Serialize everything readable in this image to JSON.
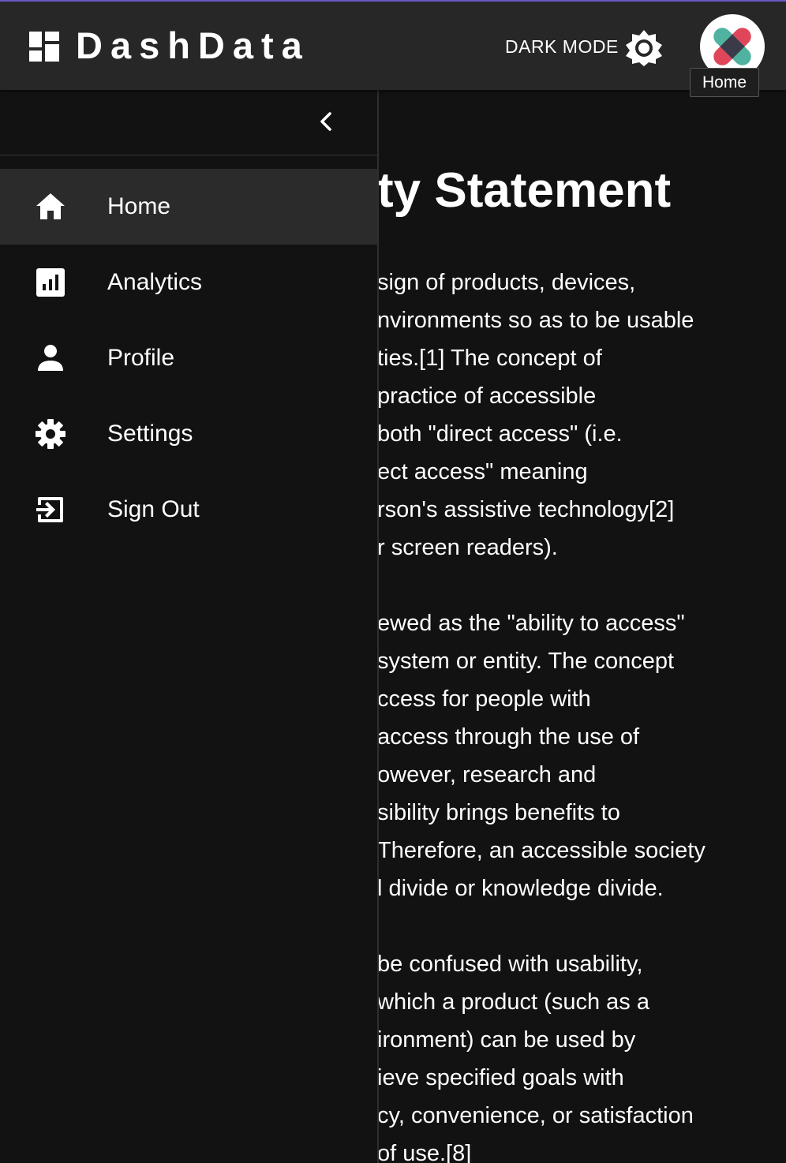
{
  "app": {
    "brand": "DashData",
    "dark_mode_label": "DARK MODE",
    "tooltip": "Home"
  },
  "colors": {
    "appbar_bg": "#272727",
    "page_bg": "#121212",
    "accent_top": "#6a5acd",
    "logo_red": "#e0465a",
    "logo_teal": "#4fb3a0"
  },
  "sidebar": {
    "items": [
      {
        "label": "Home",
        "icon": "home-icon",
        "active": true
      },
      {
        "label": "Analytics",
        "icon": "analytics-icon",
        "active": false
      },
      {
        "label": "Profile",
        "icon": "person-icon",
        "active": false
      },
      {
        "label": "Settings",
        "icon": "gear-icon",
        "active": false
      },
      {
        "label": "Sign Out",
        "icon": "sign-out-icon",
        "active": false
      }
    ]
  },
  "main": {
    "title": "ty Statement",
    "paragraphs": [
      [
        "sign of products, devices,",
        "nvironments so as to be usable",
        "ties.[1] The concept of",
        " practice of accessible",
        "both \"direct access\" (i.e.",
        "ect access\" meaning",
        "rson's assistive technology[2]",
        "r screen readers)."
      ],
      [
        "ewed as the \"ability to access\"",
        " system or entity. The concept",
        "ccess for people with",
        " access through the use of",
        "owever, research and",
        "sibility brings benefits to",
        " Therefore, an accessible society",
        "l divide or knowledge divide."
      ],
      [
        "be confused with usability,",
        "which a product (such as a",
        "ironment) can be used by",
        "ieve specified goals with",
        "cy, convenience, or satisfaction",
        "of use.[8]"
      ]
    ]
  }
}
